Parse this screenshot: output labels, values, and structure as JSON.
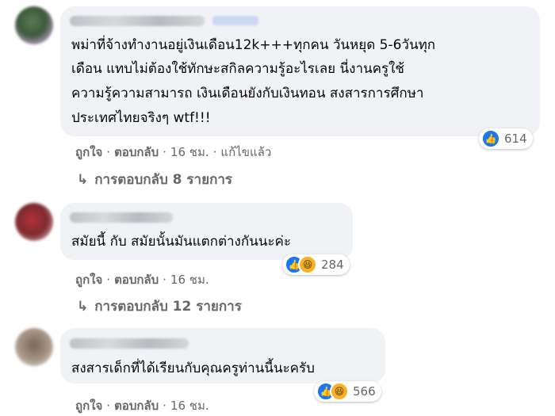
{
  "comments": [
    {
      "lines": [
        "พม่าที่จ้างทำงานอยู่เงินเดือน12k+++ทุกคน วันหยุด 5-6วันทุก",
        "เดือน แทบไม่ต้องใช้ทักษะสกิลความรู้อะไรเลย นี่งานครูใช้",
        "ความรู้ความสามารถ เงินเดือนยังกับเงินทอน สงสารการศึกษา",
        "ประเทศไทยจริงๆ wtf!!!"
      ],
      "reaction_count": "614",
      "actions": {
        "like": "ถูกใจ",
        "reply": "ตอบกลับ",
        "time": "16 ชม.",
        "edited": "แก้ไขแล้ว"
      },
      "replies": "การตอบกลับ 8 รายการ"
    },
    {
      "lines": [
        "สมัยนี้ กับ สมัยนั้นมันแตกต่างกันนะค่ะ"
      ],
      "reaction_count": "284",
      "actions": {
        "like": "ถูกใจ",
        "reply": "ตอบกลับ",
        "time": "16 ชม."
      },
      "replies": "การตอบกลับ 12 รายการ"
    },
    {
      "lines": [
        "สงสารเด็กที่ได้เรียนกับคุณครูท่านนี้นะครับ"
      ],
      "reaction_count": "566",
      "actions": {
        "like": "ถูกใจ",
        "reply": "ตอบกลับ",
        "time": "16 ชม."
      }
    }
  ],
  "icons": {
    "like": "thumbs-up-icon",
    "haha": "laughing-face-icon",
    "reply_arrow": "reply-arrow-icon"
  },
  "colors": {
    "bubble": "#f0f2f5",
    "like_blue": "#1877f2",
    "haha_yellow": "#f7b125",
    "meta_gray": "#65676b"
  }
}
